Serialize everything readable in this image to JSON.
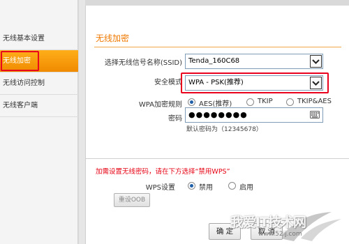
{
  "sidebar": {
    "items": [
      {
        "label": "无线基本设置",
        "active": false
      },
      {
        "label": "无线加密",
        "active": true
      },
      {
        "label": "无线访问控制",
        "active": false
      },
      {
        "label": "无线客户端",
        "active": false
      }
    ]
  },
  "main": {
    "section_title": "无线加密",
    "ssid": {
      "label": "选择无线信号名称(SSID)",
      "value": "Tenda_160C68"
    },
    "security_mode": {
      "label": "安全模式",
      "value": "WPA - PSK(推荐)"
    },
    "wpa_rule": {
      "label": "WPA加密规则",
      "options": [
        {
          "label": "AES(推荐)",
          "checked": true
        },
        {
          "label": "TKIP",
          "checked": false
        },
        {
          "label": "TKIP&AES",
          "checked": false
        }
      ]
    },
    "password": {
      "label": "密码",
      "value": "●●●●●●●●",
      "hint": "默认密码为（12345678）"
    },
    "wps_notice": "加需设置无线密码，请在下方选择“禁用WPS”",
    "wps": {
      "label": "WPS设置",
      "options": [
        {
          "label": "禁用",
          "checked": true
        },
        {
          "label": "启用",
          "checked": false
        }
      ]
    },
    "reset_oob_label": "重设OOB",
    "ok_label": "确 定",
    "cancel_label": "取 消"
  },
  "watermark": {
    "text": "我爱IT技术网",
    "url": "www.52ij.com"
  },
  "colors": {
    "accent_orange": "#f08a00",
    "highlight_red": "#e8001c",
    "notice_red": "#e60012",
    "radio_blue": "#1e5fa8"
  },
  "icons": [
    "chevron-down-icon",
    "keyboard-icon",
    "watermark-logo"
  ]
}
